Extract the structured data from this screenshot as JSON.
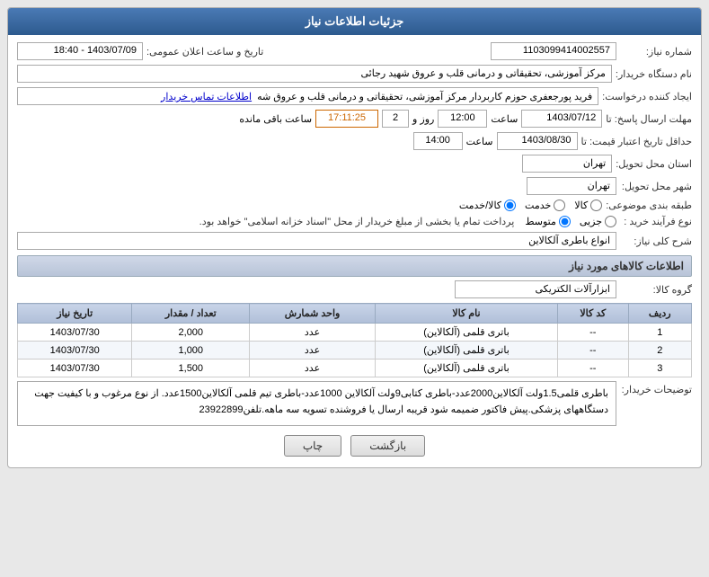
{
  "header": {
    "title": "جزئیات اطلاعات نیاز"
  },
  "fields": {
    "shomara_niaz_label": "شماره نیاز:",
    "shomara_niaz_value": "1103099414002557",
    "tarikh_label": "تاریخ و ساعت اعلان عمومی:",
    "tarikh_value": "1403/07/09 - 18:40",
    "nam_dastgah_label": "نام دستگاه خریدار:",
    "nam_dastgah_value": "مرکز آموزشی، تحقیقاتی و درمانی قلب و عروق شهید رجائی",
    "ijad_label": "ایجاد کننده درخواست:",
    "ijad_value": "فرید پورجعفری حوزم کاربردار  مرکز آموزشی، تحقیقاتی و درمانی قلب و عروق شه",
    "ijad_link": "اطلاعات تماس خریدار",
    "mohlat_label": "مهلت ارسال پاسخ: تا",
    "mohlat_date": "1403/07/12",
    "mohlat_saaat_label": "ساعت",
    "mohlat_saat_value": "12:00",
    "mohlat_rooz_label": "روز و",
    "mohlat_rooz_value": "2",
    "mohlat_baki_label": "ساعت باقی مانده",
    "mohlat_baki_value": "17:11:25",
    "jadval_label": "حداقل تاریخ اعتبار قیمت: تا",
    "jadval_date": "1403/08/30",
    "jadval_saat_label": "ساعت",
    "jadval_saat_value": "14:00",
    "ostan_label": "استان محل تحویل:",
    "ostan_value": "تهران",
    "shahr_label": "شهر محل تحویل:",
    "shahr_value": "تهران",
    "tabaqe_label": "طبقه بندی موضوعی:",
    "tabaqe_options": [
      "کالا",
      "خدمت",
      "کالا/خدمت"
    ],
    "tabaqe_selected": "کالا/خدمت",
    "noe_farayand_label": "نوع فرآیند خرید :",
    "noe_farayand_options": [
      "جزیی",
      "متوسط"
    ],
    "noe_farayand_selected": "متوسط",
    "noe_farayand_note": "پرداخت تمام یا بخشی از مبلغ خریدار از محل \"اسناد خزانه اسلامی\" خواهد بود.",
    "sareh_niaz_label": "شرح کلی نیاز:",
    "sareh_niaz_value": "انواع باطری آلکالاین",
    "info_kalaha_title": "اطلاعات کالاهای مورد نیاز",
    "grohe_kala_label": "گروه کالا:",
    "grohe_kala_value": "ابزارآلات الکتریکی",
    "table_headers": [
      "ردیف",
      "کد کالا",
      "نام کالا",
      "واحد شمارش",
      "تعداد / مقدار",
      "تاریخ نیاز"
    ],
    "table_rows": [
      {
        "radif": "1",
        "code": "--",
        "name": "باتری قلمی (آلکالاین)",
        "vahed": "عدد",
        "tedad": "2,000",
        "tarikh": "1403/07/30"
      },
      {
        "radif": "2",
        "code": "--",
        "name": "باتری قلمی (آلکالاین)",
        "vahed": "عدد",
        "tedad": "1,000",
        "tarikh": "1403/07/30"
      },
      {
        "radif": "3",
        "code": "--",
        "name": "باتری قلمی (آلکالاین)",
        "vahed": "عدد",
        "tedad": "1,500",
        "tarikh": "1403/07/30"
      }
    ],
    "buyer_notes_label": "توضیحات خریدار:",
    "buyer_notes_value": "باطری قلمی1.5ولت آلکالاین2000عدد-باطری کتابی9ولت آلکالاین 1000عدد-باطری تیم قلمی آلکالاین1500عدد. از نوع مرغوب و با کیفیت جهت دستگاههای پزشکی.پیش فاکتور ضمیمه شود قریبه ارسال یا فروشنده تسویه سه ماهه.تلفن23922899",
    "btn_back": "بازگشت",
    "btn_print": "چاپ"
  }
}
